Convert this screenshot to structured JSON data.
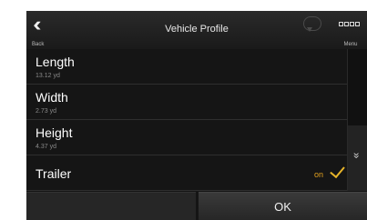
{
  "header": {
    "back_label": "Back",
    "title": "Vehicle Profile",
    "disabled_button_label": "",
    "menu_label": "Menu"
  },
  "items": [
    {
      "label": "Length",
      "value": "13.12 yd"
    },
    {
      "label": "Width",
      "value": "2.73 yd"
    },
    {
      "label": "Height",
      "value": "4.37 yd"
    }
  ],
  "trailer": {
    "label": "Trailer",
    "state": "on",
    "checked": true
  },
  "bottom": {
    "ok_label": "OK"
  },
  "colors": {
    "background": "#151515",
    "accent": "#e8b52a",
    "text": "#ffffff"
  }
}
